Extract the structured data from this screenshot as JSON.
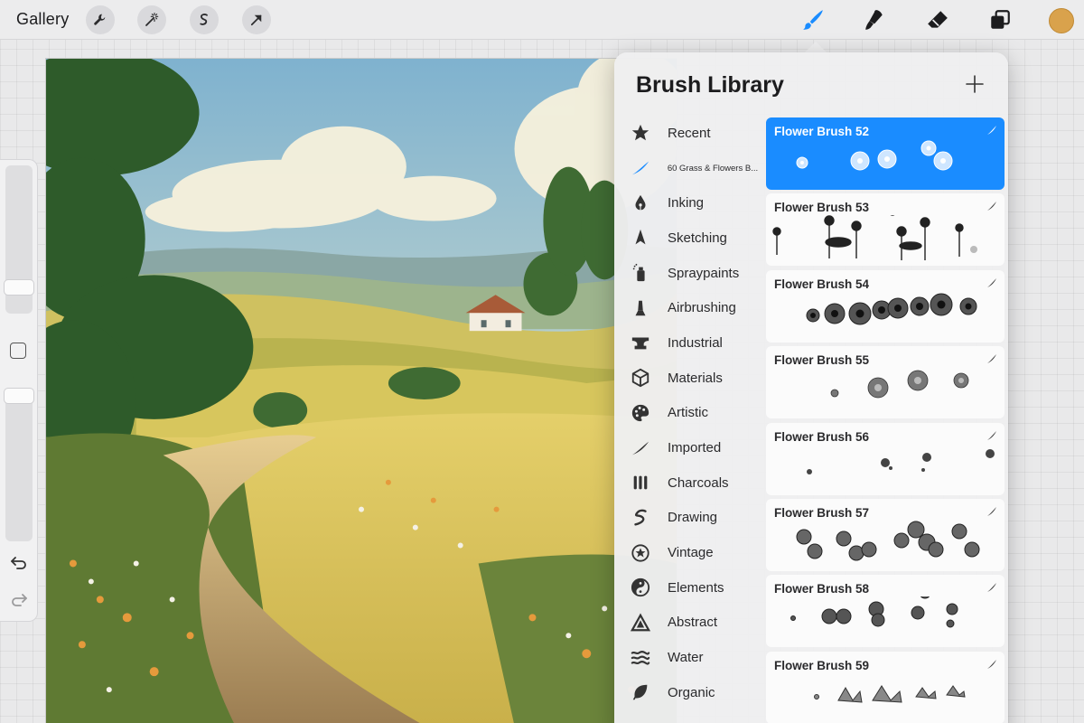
{
  "toolbar": {
    "gallery_label": "Gallery",
    "left_tools": [
      "wrench-icon",
      "magic-wand-icon",
      "selection-icon",
      "transform-arrow-icon"
    ],
    "right_tools": [
      "brush-icon",
      "smudge-icon",
      "eraser-icon",
      "layers-icon"
    ],
    "accent": "#1a8cff",
    "current_color": "#d9a24c"
  },
  "brush_library": {
    "title": "Brush Library",
    "add_label": "+",
    "sets": [
      {
        "label": "Recent",
        "icon": "star-icon"
      },
      {
        "label": "60 Grass & Flowers B...",
        "icon": "brush-stroke-icon",
        "selected": true
      },
      {
        "label": "Inking",
        "icon": "pen-nib-icon"
      },
      {
        "label": "Sketching",
        "icon": "pencil-tip-icon"
      },
      {
        "label": "Spraypaints",
        "icon": "spray-can-icon"
      },
      {
        "label": "Airbrushing",
        "icon": "airbrush-icon"
      },
      {
        "label": "Industrial",
        "icon": "anvil-icon"
      },
      {
        "label": "Materials",
        "icon": "cube-icon"
      },
      {
        "label": "Artistic",
        "icon": "palette-icon"
      },
      {
        "label": "Imported",
        "icon": "imported-stroke-icon"
      },
      {
        "label": "Charcoals",
        "icon": "charcoal-icon"
      },
      {
        "label": "Drawing",
        "icon": "squiggle-icon"
      },
      {
        "label": "Vintage",
        "icon": "vintage-star-icon"
      },
      {
        "label": "Elements",
        "icon": "yin-yang-icon"
      },
      {
        "label": "Abstract",
        "icon": "triangle-icon"
      },
      {
        "label": "Water",
        "icon": "waves-icon"
      },
      {
        "label": "Organic",
        "icon": "leaf-icon"
      }
    ],
    "brushes": [
      {
        "name": "Flower Brush 52",
        "selected": true
      },
      {
        "name": "Flower Brush 53"
      },
      {
        "name": "Flower Brush 54"
      },
      {
        "name": "Flower Brush 55"
      },
      {
        "name": "Flower Brush 56"
      },
      {
        "name": "Flower Brush 57"
      },
      {
        "name": "Flower Brush 58"
      },
      {
        "name": "Flower Brush 59"
      }
    ]
  }
}
